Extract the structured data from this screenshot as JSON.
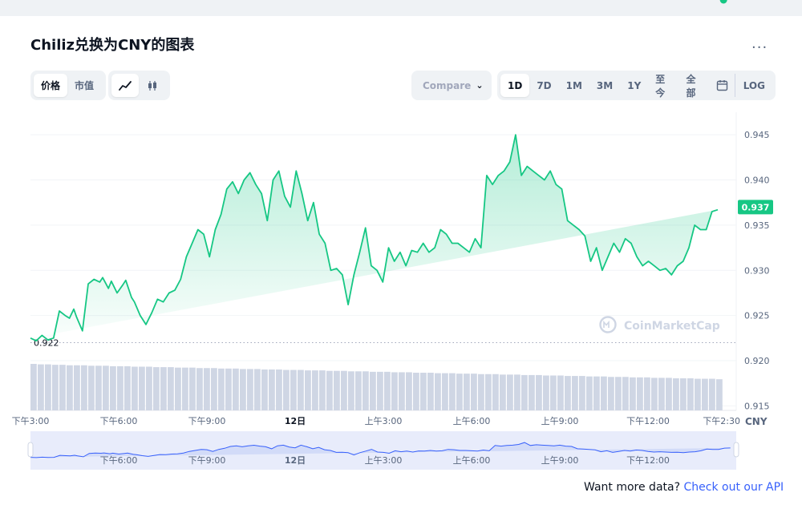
{
  "header": {
    "title": "Chiliz兑换为CNY的图表",
    "more_label": "..."
  },
  "toggles": {
    "metric": [
      {
        "label": "价格",
        "active": true
      },
      {
        "label": "市值",
        "active": false
      }
    ],
    "chart_kind": [
      {
        "icon": "line-chart-icon",
        "active": true
      },
      {
        "icon": "candlestick-icon",
        "active": false
      }
    ]
  },
  "compare": {
    "label": "Compare"
  },
  "ranges": [
    {
      "label": "1D",
      "active": true
    },
    {
      "label": "7D",
      "active": false
    },
    {
      "label": "1M",
      "active": false
    },
    {
      "label": "3M",
      "active": false
    },
    {
      "label": "1Y",
      "active": false
    },
    {
      "label": "至今",
      "active": false
    },
    {
      "label": "全部",
      "active": false
    },
    {
      "icon": "calendar-icon",
      "active": false
    },
    {
      "label": "LOG",
      "active": false
    }
  ],
  "watermark": "CoinMarketCap",
  "footer": {
    "text": "Want more data?",
    "link": "Check out our API"
  },
  "colors": {
    "line": "#16c784",
    "navigator_line": "#3861fb",
    "volume": "#cfd6e4"
  },
  "chart_data": {
    "type": "area",
    "currency_label": "CNY",
    "open_price_label": "0.922",
    "open_price": 0.922,
    "last_price_label": "0.937",
    "last_price": 0.937,
    "ylim": [
      0.9145,
      0.9475
    ],
    "y_ticks": [
      0.945,
      0.94,
      0.935,
      0.93,
      0.925,
      0.92,
      0.915
    ],
    "y_tick_labels": [
      "0.945",
      "0.940",
      "0.935",
      "0.930",
      "0.925",
      "0.920",
      "0.915"
    ],
    "x_tick_labels": [
      "下午3:00",
      "下午6:00",
      "下午9:00",
      "12日",
      "上午3:00",
      "上午6:00",
      "上午9:00",
      "下午12:00",
      "下午2:30"
    ],
    "x_tick_hours": [
      0,
      3,
      6,
      9,
      12,
      15,
      18,
      21,
      23.5
    ],
    "x_tick_bold": [
      false,
      false,
      false,
      true,
      false,
      false,
      false,
      false,
      false
    ],
    "navigator_tick_labels": [
      "下午6:00",
      "下午9:00",
      "12日",
      "上午3:00",
      "上午6:00",
      "上午9:00",
      "下午12:00"
    ],
    "navigator_tick_hours": [
      3,
      6,
      9,
      12,
      15,
      18,
      21
    ],
    "x_range_hours": [
      0,
      24
    ],
    "series": [
      {
        "hours": [
          0,
          0.2,
          0.4,
          0.6,
          0.8,
          1.0,
          1.2,
          1.35,
          1.5,
          1.6,
          1.8,
          2.0,
          2.2,
          2.4,
          2.5,
          2.7,
          2.8,
          3.0,
          3.2,
          3.3,
          3.5,
          3.6,
          3.8,
          4.0,
          4.2,
          4.4,
          4.6,
          4.8,
          5.0,
          5.2,
          5.4,
          5.6,
          5.8,
          6.0,
          6.2,
          6.4,
          6.6,
          6.8,
          7.0,
          7.2,
          7.4,
          7.6,
          7.8,
          8.0,
          8.2,
          8.4,
          8.6,
          8.8,
          9.0,
          9.2,
          9.4,
          9.6,
          9.8,
          10.0,
          10.2,
          10.4,
          10.6,
          10.8,
          11.0,
          11.2,
          11.4,
          11.6,
          11.8,
          12.0,
          12.2,
          12.4,
          12.6,
          12.8,
          13.0,
          13.2,
          13.4,
          13.6,
          13.8,
          14.0,
          14.2,
          14.4,
          14.6,
          14.8,
          15.0,
          15.2,
          15.4,
          15.6,
          15.8,
          16.0,
          16.2,
          16.4,
          16.6,
          16.8,
          17.0,
          17.2,
          17.4,
          17.6,
          17.8,
          18.0,
          18.2,
          18.4,
          18.6,
          18.8,
          19.0,
          19.2,
          19.4,
          19.6,
          19.8,
          20.0,
          20.2,
          20.4,
          20.6,
          20.8,
          21.0,
          21.2,
          21.4,
          21.6,
          21.8,
          22.0,
          22.2,
          22.4,
          22.6,
          22.8,
          23.0,
          23.2,
          23.4,
          23.6,
          23.8,
          24.0
        ],
        "values": [
          0.9225,
          0.9222,
          0.9228,
          0.9223,
          0.9225,
          0.9255,
          0.925,
          0.9247,
          0.9257,
          0.9248,
          0.9233,
          0.9285,
          0.929,
          0.9287,
          0.9292,
          0.928,
          0.9288,
          0.9275,
          0.9284,
          0.9289,
          0.927,
          0.9265,
          0.925,
          0.924,
          0.9253,
          0.9268,
          0.9265,
          0.9275,
          0.9278,
          0.929,
          0.9315,
          0.933,
          0.9345,
          0.934,
          0.9315,
          0.9345,
          0.9362,
          0.939,
          0.9398,
          0.9385,
          0.94,
          0.9408,
          0.9395,
          0.9385,
          0.9355,
          0.94,
          0.941,
          0.9382,
          0.937,
          0.941,
          0.9385,
          0.9355,
          0.9375,
          0.934,
          0.933,
          0.93,
          0.9302,
          0.9295,
          0.9262,
          0.9295,
          0.932,
          0.9347,
          0.9305,
          0.93,
          0.9287,
          0.9325,
          0.931,
          0.932,
          0.9305,
          0.9322,
          0.932,
          0.933,
          0.932,
          0.9325,
          0.9345,
          0.934,
          0.933,
          0.933,
          0.9325,
          0.932,
          0.9335,
          0.9325,
          0.9405,
          0.9395,
          0.9405,
          0.941,
          0.942,
          0.945,
          0.9405,
          0.9415,
          0.941,
          0.9405,
          0.94,
          0.941,
          0.9395,
          0.939,
          0.9355,
          0.935,
          0.9345,
          0.9338,
          0.931,
          0.9325,
          0.93,
          0.9315,
          0.933,
          0.932,
          0.9335,
          0.933,
          0.9315,
          0.9305,
          0.931,
          0.9305,
          0.93,
          0.9302,
          0.9295,
          0.9305,
          0.931,
          0.9325,
          0.935,
          0.9345,
          0.9345,
          0.9365,
          0.9367
        ]
      }
    ],
    "volume": [
      1.0,
      0.99,
      0.99,
      0.98,
      0.98,
      0.97,
      0.97,
      0.97,
      0.96,
      0.96,
      0.96,
      0.95,
      0.95,
      0.95,
      0.94,
      0.94,
      0.94,
      0.93,
      0.93,
      0.93,
      0.92,
      0.92,
      0.92,
      0.91,
      0.91,
      0.91,
      0.9,
      0.9,
      0.9,
      0.89,
      0.89,
      0.89,
      0.88,
      0.88,
      0.88,
      0.87,
      0.87,
      0.87,
      0.86,
      0.86,
      0.86,
      0.85,
      0.85,
      0.85,
      0.84,
      0.84,
      0.84,
      0.83,
      0.83,
      0.83,
      0.82,
      0.82,
      0.82,
      0.81,
      0.81,
      0.81,
      0.8,
      0.8,
      0.8,
      0.79,
      0.79,
      0.79,
      0.78,
      0.78,
      0.78,
      0.77,
      0.77,
      0.77,
      0.76,
      0.76,
      0.76,
      0.75,
      0.75,
      0.75,
      0.74,
      0.74,
      0.74,
      0.73,
      0.73,
      0.73,
      0.72,
      0.72,
      0.72,
      0.71,
      0.71,
      0.71,
      0.7,
      0.7,
      0.7,
      0.69,
      0.69,
      0.69,
      0.68,
      0.68,
      0.68,
      0.67
    ]
  }
}
